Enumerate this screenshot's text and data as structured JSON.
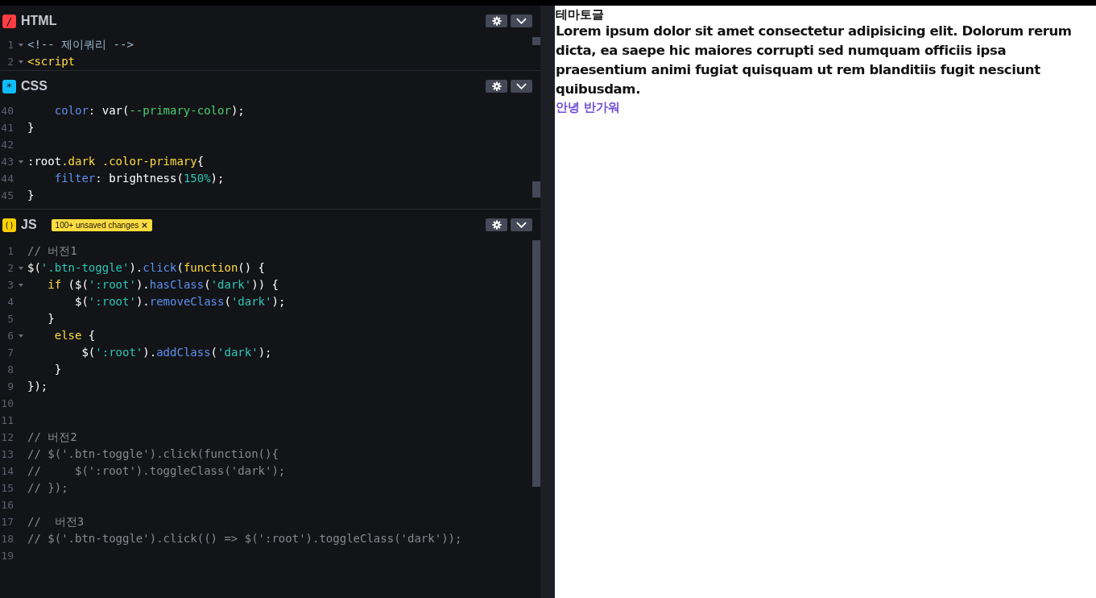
{
  "editors": [
    {
      "kind": "html",
      "icon": "/",
      "title": "HTML",
      "lines": [
        {
          "number": "1",
          "fold": true,
          "tokens": [
            {
              "kind": "tag",
              "text": "<!-- 제이쿼리 -->"
            }
          ]
        },
        {
          "number": "2",
          "fold": true,
          "tokens": [
            {
              "kind": "keyword",
              "text": "<script"
            }
          ]
        }
      ]
    },
    {
      "kind": "css",
      "icon": "*",
      "title": "CSS",
      "lines": [
        {
          "number": "40",
          "fold": false,
          "tokens": [
            {
              "kind": "method",
              "text": "    color"
            },
            {
              "kind": "plain",
              "text": ": var("
            },
            {
              "kind": "value",
              "text": "--primary-color"
            },
            {
              "kind": "plain",
              "text": ");"
            }
          ]
        },
        {
          "number": "41",
          "fold": false,
          "tokens": [
            {
              "kind": "plain",
              "text": "}"
            }
          ]
        },
        {
          "number": "42",
          "fold": false
        },
        {
          "number": "43",
          "fold": true,
          "tokens": [
            {
              "kind": "plain",
              "text": ":root"
            },
            {
              "kind": "keyword",
              "text": ".dark .color-primary"
            },
            {
              "kind": "plain",
              "text": "{"
            }
          ]
        },
        {
          "number": "44",
          "fold": false,
          "tokens": [
            {
              "kind": "method",
              "text": "    filter"
            },
            {
              "kind": "plain",
              "text": ": brightness("
            },
            {
              "kind": "string",
              "text": "150%"
            },
            {
              "kind": "plain",
              "text": ");"
            }
          ]
        },
        {
          "number": "45",
          "fold": false,
          "tokens": [
            {
              "kind": "plain",
              "text": "}"
            }
          ]
        }
      ]
    },
    {
      "kind": "js",
      "icon": "()",
      "title": "JS",
      "badge": "100+ unsaved changes",
      "lines": [
        {
          "number": "1",
          "fold": false,
          "tokens": [
            {
              "kind": "comment",
              "text": "// 버전1"
            }
          ]
        },
        {
          "number": "2",
          "fold": true,
          "tokens": [
            {
              "kind": "plain",
              "text": "$("
            },
            {
              "kind": "string",
              "text": "'.btn-toggle'"
            },
            {
              "kind": "plain",
              "text": ")."
            },
            {
              "kind": "method",
              "text": "click"
            },
            {
              "kind": "plain",
              "text": "("
            },
            {
              "kind": "keyword",
              "text": "function"
            },
            {
              "kind": "plain",
              "text": "() {"
            }
          ]
        },
        {
          "number": "3",
          "fold": true,
          "tokens": [
            {
              "kind": "keyword",
              "text": "   if"
            },
            {
              "kind": "plain",
              "text": " ($("
            },
            {
              "kind": "string",
              "text": "':root'"
            },
            {
              "kind": "plain",
              "text": ")."
            },
            {
              "kind": "method",
              "text": "hasClass"
            },
            {
              "kind": "plain",
              "text": "("
            },
            {
              "kind": "string",
              "text": "'dark'"
            },
            {
              "kind": "plain",
              "text": ")) {"
            }
          ]
        },
        {
          "number": "4",
          "fold": false,
          "tokens": [
            {
              "kind": "plain",
              "text": "       $("
            },
            {
              "kind": "string",
              "text": "':root'"
            },
            {
              "kind": "plain",
              "text": ")."
            },
            {
              "kind": "method",
              "text": "removeClass"
            },
            {
              "kind": "plain",
              "text": "("
            },
            {
              "kind": "string",
              "text": "'dark'"
            },
            {
              "kind": "plain",
              "text": ");"
            }
          ]
        },
        {
          "number": "5",
          "fold": false,
          "tokens": [
            {
              "kind": "plain",
              "text": "   }"
            }
          ]
        },
        {
          "number": "6",
          "fold": true,
          "tokens": [
            {
              "kind": "keyword",
              "text": "    else"
            },
            {
              "kind": "plain",
              "text": " {"
            }
          ]
        },
        {
          "number": "7",
          "fold": false,
          "tokens": [
            {
              "kind": "plain",
              "text": "        $("
            },
            {
              "kind": "string",
              "text": "':root'"
            },
            {
              "kind": "plain",
              "text": ")."
            },
            {
              "kind": "method",
              "text": "addClass"
            },
            {
              "kind": "plain",
              "text": "("
            },
            {
              "kind": "string",
              "text": "'dark'"
            },
            {
              "kind": "plain",
              "text": ");"
            }
          ]
        },
        {
          "number": "8",
          "fold": false,
          "tokens": [
            {
              "kind": "plain",
              "text": "    }"
            }
          ]
        },
        {
          "number": "9",
          "fold": false,
          "tokens": [
            {
              "kind": "plain",
              "text": "});"
            }
          ]
        },
        {
          "number": "10",
          "fold": false
        },
        {
          "number": "11",
          "fold": false
        },
        {
          "number": "12",
          "fold": false,
          "tokens": [
            {
              "kind": "comment",
              "text": "// 버전2"
            }
          ]
        },
        {
          "number": "13",
          "fold": false,
          "tokens": [
            {
              "kind": "comment",
              "text": "// $('.btn-toggle').click(function(){"
            }
          ]
        },
        {
          "number": "14",
          "fold": false,
          "tokens": [
            {
              "kind": "comment",
              "text": "//     $(':root').toggleClass('dark');"
            }
          ]
        },
        {
          "number": "15",
          "fold": false,
          "tokens": [
            {
              "kind": "comment",
              "text": "// });"
            }
          ]
        },
        {
          "number": "16",
          "fold": false
        },
        {
          "number": "17",
          "fold": false,
          "tokens": [
            {
              "kind": "comment",
              "text": "//  버전3"
            }
          ]
        },
        {
          "number": "18",
          "fold": false,
          "tokens": [
            {
              "kind": "comment",
              "text": "// $('.btn-toggle').click(() => $(':root').toggleClass('dark'));"
            }
          ]
        },
        {
          "number": "19",
          "fold": false
        }
      ]
    }
  ],
  "preview": {
    "heading": "테마토글",
    "paragraph": "Lorem ipsum dolor sit amet consectetur adipisicing elit. Dolorum rerum dicta, ea saepe hic maiores corrupti sed numquam officiis ipsa praesentium animi fugiat quisquam ut rem blanditiis fugit nesciunt quibusdam.",
    "link": "안녕 반가워"
  }
}
